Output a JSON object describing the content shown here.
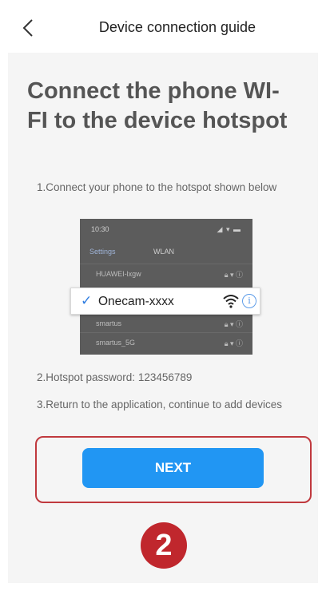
{
  "header": {
    "title": "Device connection guide",
    "back_icon": "chevron-left-icon"
  },
  "main": {
    "title": "Connect the phone WI-FI to the device hotspot",
    "step1": "1.Connect your phone to the hotspot shown below",
    "step2": "2.Hotspot password: 123456789",
    "step3": "3.Return to the application, continue to add devices"
  },
  "screenshot": {
    "status_time": "10:30",
    "nav_back": "Settings",
    "nav_title": "WLAN",
    "networks": [
      {
        "name": "HUAWEI-lxgw"
      },
      {
        "name": "smartus"
      },
      {
        "name": "smartus_5G"
      }
    ],
    "hotspot": {
      "name": "Onecam-xxxx",
      "icons": [
        "check-icon",
        "wifi-icon",
        "info-icon"
      ]
    }
  },
  "next_button": {
    "label": "NEXT"
  },
  "step_badge": {
    "number": "2"
  },
  "colors": {
    "accent_blue": "#2196f3",
    "highlight_red": "#c0393e",
    "badge_red": "#c0272d",
    "panel_bg": "#f5f5f5"
  }
}
